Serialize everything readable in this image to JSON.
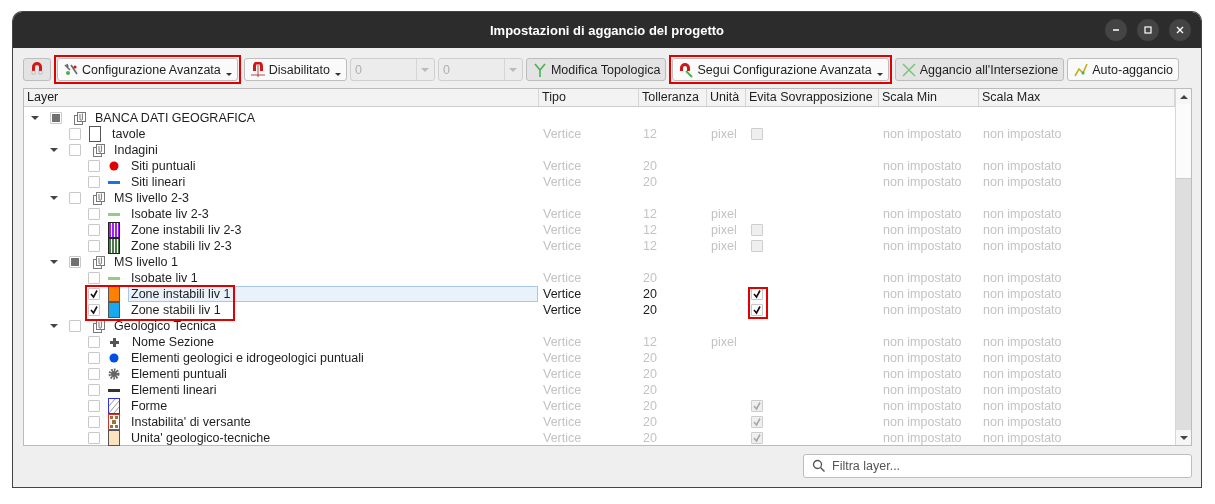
{
  "window": {
    "title": "Impostazioni di aggancio del progetto"
  },
  "toolbar": [
    {
      "kind": "button",
      "pressed": true,
      "highlighted": false
    },
    {
      "kind": "dropdown",
      "label": "Configurazione Avanzata",
      "pressed": false,
      "highlighted": true
    },
    {
      "kind": "dropdown",
      "label": "Disabilitato",
      "pressed": false,
      "highlighted": false
    },
    {
      "kind": "combo",
      "value": "0",
      "disabled": true
    },
    {
      "kind": "combo",
      "value": "0",
      "disabled": true
    },
    {
      "kind": "button",
      "label": "Modifica Topologica",
      "pressed": true,
      "highlighted": false
    },
    {
      "kind": "dropdown",
      "label": "Segui Configurazione Avanzata",
      "pressed": false,
      "highlighted": true
    },
    {
      "kind": "button",
      "label": "Aggancio all'Intersezione",
      "pressed": true,
      "highlighted": false
    },
    {
      "kind": "button",
      "label": "Auto-aggancio",
      "pressed": false,
      "highlighted": false
    }
  ],
  "table": {
    "columns": [
      "Layer",
      "Tipo",
      "Tolleranza",
      "Unità",
      "Evita Sovrapposizione",
      "Scala Min",
      "Scala Max"
    ],
    "rows": [
      {
        "kind": "group",
        "name": "BANCA DATI GEOGRAFICA",
        "checked": false,
        "partial": true,
        "expanded": true,
        "selected": false,
        "children": [
          {
            "kind": "layer",
            "name": "tavole",
            "checked": false,
            "selected": false,
            "enabled": false,
            "highlighted": false,
            "symbol": {
              "kind": "none",
              "color": "#555555"
            },
            "type": "Vertice",
            "tolerance": "12",
            "unit": "pixel",
            "avoid_overlap_checked": false,
            "scale_min": "non impostato",
            "scale_max": "non impostato"
          },
          {
            "kind": "group",
            "name": "Indagini",
            "checked": false,
            "partial": false,
            "expanded": true,
            "selected": false,
            "children": [
              {
                "kind": "layer",
                "name": "Siti puntuali",
                "checked": false,
                "selected": false,
                "enabled": false,
                "highlighted": false,
                "symbol": {
                  "kind": "dot",
                  "color": "#e00000"
                },
                "type": "Vertice",
                "tolerance": "20",
                "scale_min": "non impostato",
                "scale_max": "non impostato"
              },
              {
                "kind": "layer",
                "name": "Siti lineari",
                "checked": false,
                "selected": false,
                "enabled": false,
                "highlighted": false,
                "symbol": {
                  "kind": "line",
                  "color": "#1e6fe8"
                },
                "type": "Vertice",
                "tolerance": "20",
                "scale_min": "non impostato",
                "scale_max": "non impostato"
              }
            ]
          },
          {
            "kind": "group",
            "name": "MS livello 2-3",
            "checked": false,
            "partial": false,
            "expanded": true,
            "selected": false,
            "children": [
              {
                "kind": "layer",
                "name": "Isobate liv 2-3",
                "checked": false,
                "selected": false,
                "enabled": false,
                "highlighted": false,
                "symbol": {
                  "kind": "line",
                  "color": "#8fcf7f"
                },
                "type": "Vertice",
                "tolerance": "12",
                "unit": "pixel",
                "scale_min": "non impostato",
                "scale_max": "non impostato"
              },
              {
                "kind": "layer",
                "name": "Zone instabili liv 2-3",
                "checked": false,
                "selected": false,
                "enabled": false,
                "highlighted": false,
                "symbol": {
                  "kind": "stripes",
                  "color": "#a020f0"
                },
                "type": "Vertice",
                "tolerance": "12",
                "unit": "pixel",
                "avoid_overlap_checked": false,
                "scale_min": "non impostato",
                "scale_max": "non impostato"
              },
              {
                "kind": "layer",
                "name": "Zone stabili liv 2-3",
                "checked": false,
                "selected": false,
                "enabled": false,
                "highlighted": false,
                "symbol": {
                  "kind": "stripes",
                  "color": "#4a7a4a"
                },
                "type": "Vertice",
                "tolerance": "12",
                "unit": "pixel",
                "avoid_overlap_checked": false,
                "scale_min": "non impostato",
                "scale_max": "non impostato"
              }
            ]
          },
          {
            "kind": "group",
            "name": "MS livello 1",
            "checked": false,
            "partial": true,
            "expanded": true,
            "selected": false,
            "children": [
              {
                "kind": "layer",
                "name": "Isobate liv 1",
                "checked": false,
                "selected": false,
                "enabled": false,
                "highlighted": false,
                "symbol": {
                  "kind": "line",
                  "color": "#8fcf7f"
                },
                "type": "Vertice",
                "tolerance": "20",
                "scale_min": "non impostato",
                "scale_max": "non impostato"
              },
              {
                "kind": "layer",
                "name": "Zone instabili liv 1",
                "checked": true,
                "selected": true,
                "enabled": true,
                "highlighted": true,
                "symbol": {
                  "kind": "fill",
                  "color": "#ff8000"
                },
                "type": "Vertice",
                "tolerance": "20",
                "avoid_overlap_checked": true,
                "scale_min": "non impostato",
                "scale_max": "non impostato"
              },
              {
                "kind": "layer",
                "name": "Zone stabili liv 1",
                "checked": true,
                "selected": false,
                "enabled": true,
                "highlighted": true,
                "symbol": {
                  "kind": "fill",
                  "color": "#18a8f0"
                },
                "type": "Vertice",
                "tolerance": "20",
                "avoid_overlap_checked": true,
                "scale_min": "non impostato",
                "scale_max": "non impostato"
              }
            ]
          },
          {
            "kind": "group",
            "name": "Geologico Tecnica",
            "checked": false,
            "partial": false,
            "expanded": true,
            "selected": false,
            "children": [
              {
                "kind": "layer",
                "name": "Nome Sezione",
                "checked": false,
                "selected": false,
                "enabled": false,
                "highlighted": false,
                "symbol": {
                  "kind": "plus",
                  "color": "#555555"
                },
                "type": "Vertice",
                "tolerance": "12",
                "unit": "pixel",
                "scale_min": "non impostato",
                "scale_max": "non impostato"
              },
              {
                "kind": "layer",
                "name": "Elementi geologici e idrogeologici puntuali",
                "checked": false,
                "selected": false,
                "enabled": false,
                "highlighted": false,
                "symbol": {
                  "kind": "dot",
                  "color": "#0050e0"
                },
                "type": "Vertice",
                "tolerance": "20",
                "scale_min": "non impostato",
                "scale_max": "non impostato"
              },
              {
                "kind": "layer",
                "name": "Elementi puntuali",
                "checked": false,
                "selected": false,
                "enabled": false,
                "highlighted": false,
                "symbol": {
                  "kind": "gear",
                  "color": "#666666"
                },
                "type": "Vertice",
                "tolerance": "20",
                "scale_min": "non impostato",
                "scale_max": "non impostato"
              },
              {
                "kind": "layer",
                "name": "Elementi lineari",
                "checked": false,
                "selected": false,
                "enabled": false,
                "highlighted": false,
                "symbol": {
                  "kind": "line",
                  "color": "#333333"
                },
                "type": "Vertice",
                "tolerance": "20",
                "scale_min": "non impostato",
                "scale_max": "non impostato"
              },
              {
                "kind": "layer",
                "name": "Forme",
                "checked": false,
                "selected": false,
                "enabled": false,
                "highlighted": false,
                "symbol": {
                  "kind": "hatch",
                  "color": "#3030e0"
                },
                "type": "Vertice",
                "tolerance": "20",
                "avoid_overlap_checked": true,
                "scale_min": "non impostato",
                "scale_max": "non impostato"
              },
              {
                "kind": "layer",
                "name": "Instabilita' di versante",
                "checked": false,
                "selected": false,
                "enabled": false,
                "highlighted": false,
                "symbol": {
                  "kind": "dots",
                  "color": "#a0703a"
                },
                "type": "Vertice",
                "tolerance": "20",
                "avoid_overlap_checked": true,
                "scale_min": "non impostato",
                "scale_max": "non impostato"
              },
              {
                "kind": "layer",
                "name": "Unita' geologico-tecniche",
                "checked": false,
                "selected": false,
                "enabled": false,
                "highlighted": false,
                "symbol": {
                  "kind": "fill",
                  "color": "#fde2bf"
                },
                "type": "Vertice",
                "tolerance": "20",
                "avoid_overlap_checked": true,
                "scale_min": "non impostato",
                "scale_max": "non impostato"
              }
            ]
          }
        ]
      }
    ]
  },
  "filter": {
    "placeholder": "Filtra layer..."
  }
}
